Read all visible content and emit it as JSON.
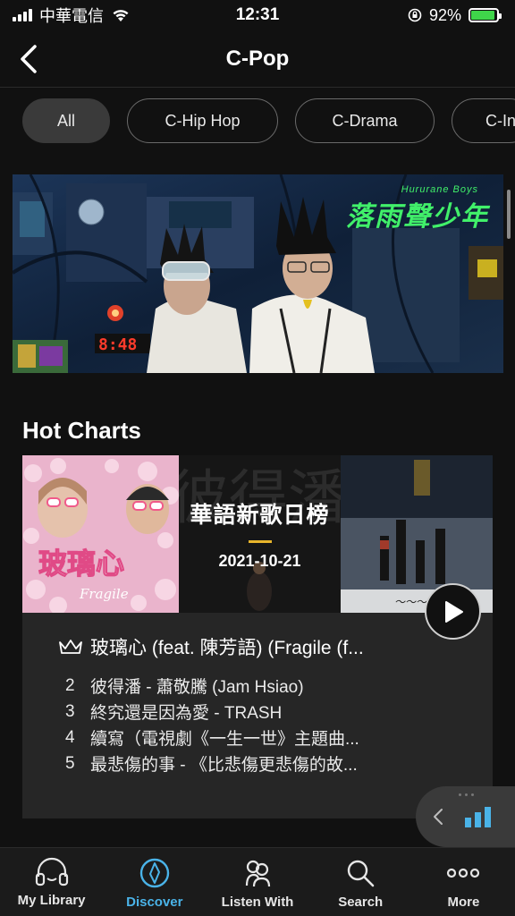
{
  "status_bar": {
    "carrier": "中華電信",
    "time": "12:31",
    "battery_percent": "92%",
    "battery_level": 0.92,
    "battery_color": "#3fd54a"
  },
  "header": {
    "title": "C-Pop"
  },
  "genre_chips": [
    {
      "label": "All",
      "active": true
    },
    {
      "label": "C-Hip Hop",
      "active": false
    },
    {
      "label": "C-Drama",
      "active": false
    },
    {
      "label": "C-In",
      "active": false
    }
  ],
  "banner": {
    "title": "落雨聲少年",
    "subtitle": "Hururane Boys"
  },
  "hot_charts": {
    "section_title": "Hot Charts",
    "chart_name": "華語新歌日榜",
    "date": "2021-10-21",
    "top_track": "玻璃心 (feat. 陳芳語) (Fragile (f...",
    "tracks": [
      {
        "rank": "2",
        "title": "彼得潘 - 蕭敬騰 (Jam Hsiao)"
      },
      {
        "rank": "3",
        "title": "終究還是因為愛 - TRASH"
      },
      {
        "rank": "4",
        "title": "續寫（電視劇《一生一世》主題曲..."
      },
      {
        "rank": "5",
        "title": "最悲傷的事 - 《比悲傷更悲傷的故..."
      }
    ],
    "cover_1_text": "玻璃心",
    "cover_1_sub": "Fragile",
    "cover_2_text": "彼得潘"
  },
  "tab_bar": {
    "tabs": [
      {
        "label": "My Library",
        "icon": "headphones-icon",
        "active": false
      },
      {
        "label": "Discover",
        "icon": "compass-icon",
        "active": true
      },
      {
        "label": "Listen With",
        "icon": "listen-with-icon",
        "active": false
      },
      {
        "label": "Search",
        "icon": "search-icon",
        "active": false
      },
      {
        "label": "More",
        "icon": "more-dots-icon",
        "active": false
      }
    ]
  },
  "colors": {
    "accent": "#4ab3e8",
    "background": "#111111",
    "card": "#262626"
  }
}
